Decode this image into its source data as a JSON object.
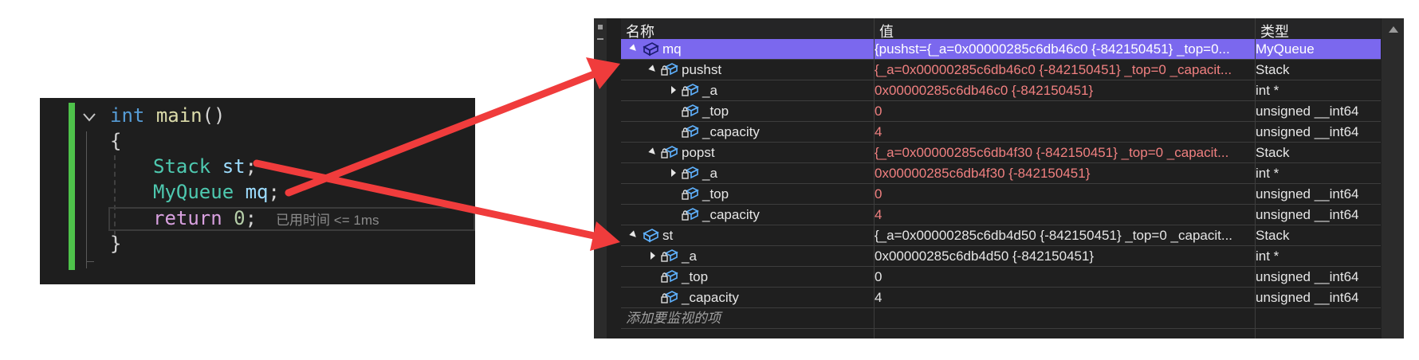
{
  "editor": {
    "lines": {
      "l1_kw": "int",
      "l1_fn": "main",
      "l1_rest": "()",
      "l2": "{",
      "l3_type": "Stack",
      "l3_var": "st",
      "l3_semi": ";",
      "l4_type": "MyQueue",
      "l4_var": "mq",
      "l4_semi": ";",
      "l5_kw": "return",
      "l5_num": "0",
      "l5_semi": ";",
      "l6": "}"
    },
    "elapsed_hint": "已用时间 <= 1ms",
    "change_bar_color": "#4ec24a"
  },
  "watch": {
    "columns": {
      "name": "名称",
      "value": "值",
      "type": "类型"
    },
    "rows": [
      {
        "name": "mq",
        "value": "{pushst={_a=0x00000285c6db46c0 {-842150451} _top=0...",
        "type": "MyQueue"
      },
      {
        "name": "pushst",
        "value": "{_a=0x00000285c6db46c0 {-842150451} _top=0 _capacit...",
        "type": "Stack"
      },
      {
        "name": "_a",
        "value": "0x00000285c6db46c0 {-842150451}",
        "type": "int *"
      },
      {
        "name": "_top",
        "value": "0",
        "type": "unsigned __int64"
      },
      {
        "name": "_capacity",
        "value": "4",
        "type": "unsigned __int64"
      },
      {
        "name": "popst",
        "value": "{_a=0x00000285c6db4f30 {-842150451} _top=0 _capacit...",
        "type": "Stack"
      },
      {
        "name": "_a",
        "value": "0x00000285c6db4f30 {-842150451}",
        "type": "int *"
      },
      {
        "name": "_top",
        "value": "0",
        "type": "unsigned __int64"
      },
      {
        "name": "_capacity",
        "value": "4",
        "type": "unsigned __int64"
      },
      {
        "name": "st",
        "value": "{_a=0x00000285c6db4d50 {-842150451} _top=0 _capacit...",
        "type": "Stack"
      },
      {
        "name": "_a",
        "value": "0x00000285c6db4d50 {-842150451}",
        "type": "int *"
      },
      {
        "name": "_top",
        "value": "0",
        "type": "unsigned __int64"
      },
      {
        "name": "_capacity",
        "value": "4",
        "type": "unsigned __int64"
      }
    ],
    "add_item": "添加要监视的项",
    "selected_color": "#7b68ee"
  },
  "annotation": {
    "arrow_color": "#f03c3c"
  }
}
